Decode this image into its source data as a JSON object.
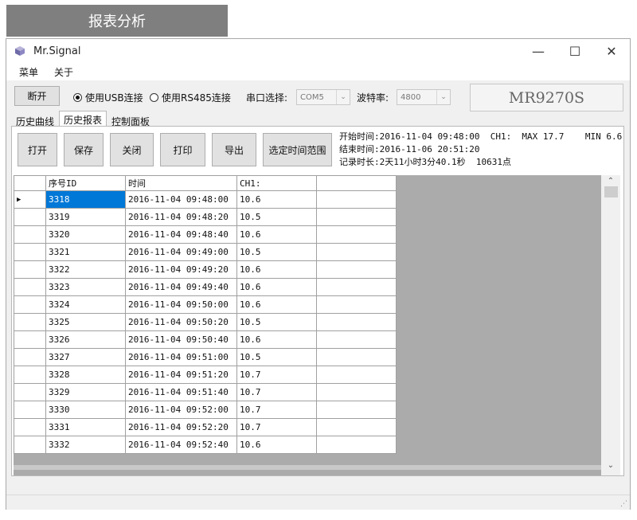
{
  "banner": {
    "title": "报表分析"
  },
  "window": {
    "title": "Mr.Signal",
    "controls": {
      "minimize": "—",
      "maximize": "☐",
      "close": "✕"
    }
  },
  "menu": {
    "items": [
      "菜单",
      "关于"
    ]
  },
  "connection": {
    "disconnect_label": "断开",
    "usb_label": "使用USB连接",
    "usb_selected": true,
    "rs485_label": "使用RS485连接",
    "port_label": "串口选择:",
    "port_value": "COM5",
    "baud_label": "波特率:",
    "baud_value": "4800",
    "model": "MR9270S"
  },
  "tabs": [
    {
      "label": "历史曲线",
      "active": false
    },
    {
      "label": "历史报表",
      "active": true
    },
    {
      "label": "控制面板",
      "active": false
    }
  ],
  "actions": {
    "open": "打开",
    "save": "保存",
    "close": "关闭",
    "print": "打印",
    "export": "导出",
    "select_range": "选定时间范围"
  },
  "info": {
    "start_line": "开始时间:2016-11-04 09:48:00  CH1:  MAX 17.7    MIN 6.6",
    "end_line": "结束时间:2016-11-06 20:51:20",
    "duration_line": "记录时长:2天11小时3分40.1秒  10631点"
  },
  "table": {
    "headers": [
      "",
      "序号ID",
      "时间",
      "CH1:",
      ""
    ],
    "rows": [
      {
        "id": "3318",
        "time": "2016-11-04 09:48:00",
        "ch1": "10.6"
      },
      {
        "id": "3319",
        "time": "2016-11-04 09:48:20",
        "ch1": "10.5"
      },
      {
        "id": "3320",
        "time": "2016-11-04 09:48:40",
        "ch1": "10.6"
      },
      {
        "id": "3321",
        "time": "2016-11-04 09:49:00",
        "ch1": "10.5"
      },
      {
        "id": "3322",
        "time": "2016-11-04 09:49:20",
        "ch1": "10.6"
      },
      {
        "id": "3323",
        "time": "2016-11-04 09:49:40",
        "ch1": "10.6"
      },
      {
        "id": "3324",
        "time": "2016-11-04 09:50:00",
        "ch1": "10.6"
      },
      {
        "id": "3325",
        "time": "2016-11-04 09:50:20",
        "ch1": "10.5"
      },
      {
        "id": "3326",
        "time": "2016-11-04 09:50:40",
        "ch1": "10.6"
      },
      {
        "id": "3327",
        "time": "2016-11-04 09:51:00",
        "ch1": "10.5"
      },
      {
        "id": "3328",
        "time": "2016-11-04 09:51:20",
        "ch1": "10.7"
      },
      {
        "id": "3329",
        "time": "2016-11-04 09:51:40",
        "ch1": "10.7"
      },
      {
        "id": "3330",
        "time": "2016-11-04 09:52:00",
        "ch1": "10.7"
      },
      {
        "id": "3331",
        "time": "2016-11-04 09:52:20",
        "ch1": "10.7"
      },
      {
        "id": "3332",
        "time": "2016-11-04 09:52:40",
        "ch1": "10.6"
      }
    ],
    "selected_row": 0,
    "current_row_marker": "▶"
  },
  "colors": {
    "selection": "#0078d7",
    "grid_background": "#ababab",
    "banner": "#7f7f7f"
  }
}
